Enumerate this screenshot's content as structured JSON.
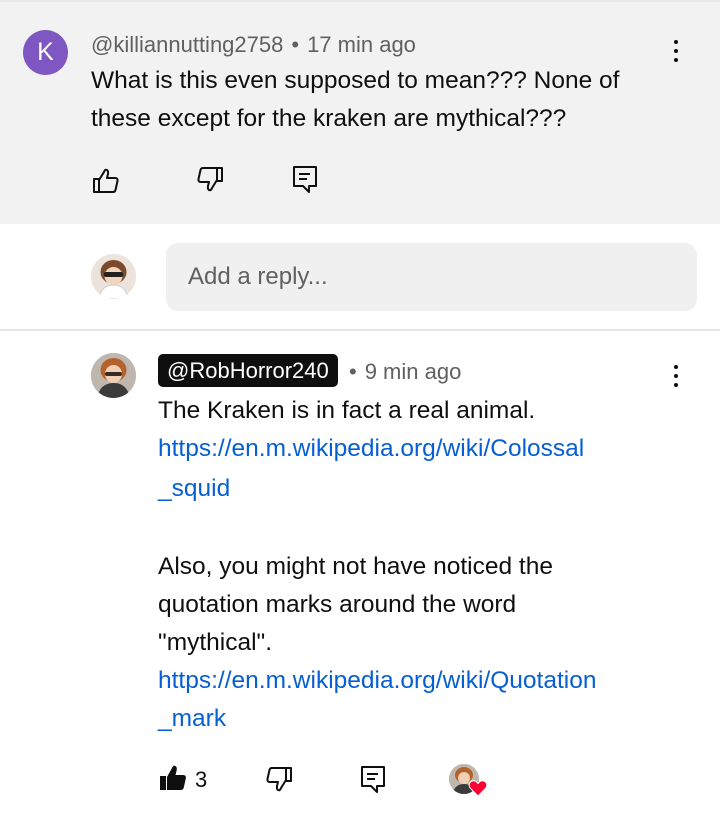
{
  "comment": {
    "avatar_letter": "K",
    "avatar_color": "#7e57c2",
    "author": "@killiannutting2758",
    "separator": "•",
    "time": "17 min ago",
    "text_line1": "What is this even supposed to mean??? None of",
    "text_line2": "these except for the kraken are mythical???",
    "icons": [
      "like-icon",
      "dislike-icon",
      "reply-icon",
      "more-vert-icon"
    ]
  },
  "reply_input": {
    "placeholder": "Add a reply..."
  },
  "reply": {
    "author": "@RobHorror240",
    "separator": "•",
    "time": "9 min ago",
    "line1": "The Kraken is in fact a real animal.",
    "link1_line1": "https://en.m.wikipedia.org/wiki/Colossal",
    "link1_line2": "_squid",
    "line2": "Also, you might not have noticed the",
    "line3": "quotation marks around the word",
    "line4": "\"mythical\".",
    "link2_line1": "https://en.m.wikipedia.org/wiki/Quotation",
    "link2_line2": "_mark",
    "like_count": "3",
    "link_color": "#065fd4",
    "heart_color": "#ff0033",
    "icons": [
      "like-filled-icon",
      "dislike-icon",
      "reply-icon",
      "creator-heart-icon",
      "more-vert-icon"
    ]
  }
}
